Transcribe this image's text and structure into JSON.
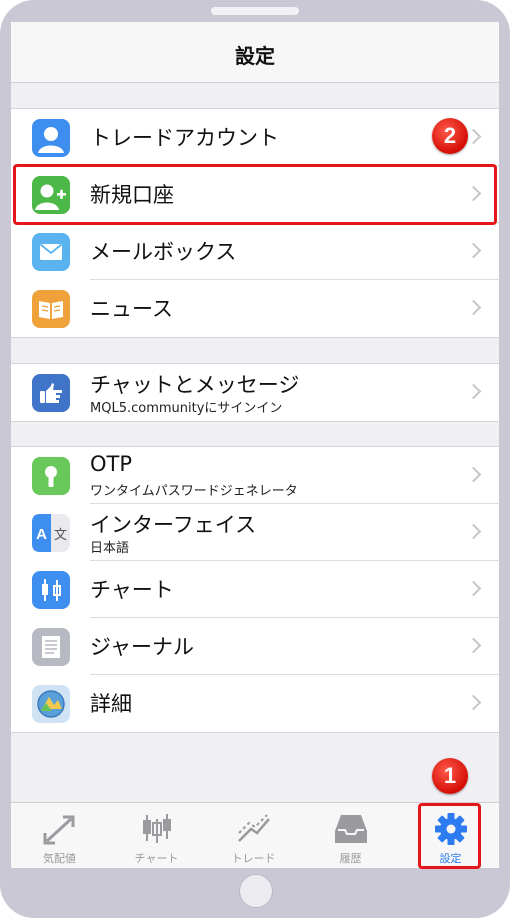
{
  "nav": {
    "title": "設定"
  },
  "groups": [
    {
      "items": [
        {
          "label": "トレードアカウント",
          "icon": "contact-icon",
          "color": "#3e8ef0"
        },
        {
          "label": "新規口座",
          "icon": "add-user-icon",
          "color": "#4cb848"
        },
        {
          "label": "メールボックス",
          "icon": "envelope-icon",
          "color": "#5ab3ef"
        },
        {
          "label": "ニュース",
          "icon": "book-icon",
          "color": "#f0a23a"
        }
      ]
    },
    {
      "items": [
        {
          "label": "チャットとメッセージ",
          "sub": "MQL5.communityにサインイン",
          "icon": "hand-pointer-icon",
          "color": "#3f74c8"
        }
      ]
    },
    {
      "items": [
        {
          "label": "OTP",
          "sub": "ワンタイムパスワードジェネレータ",
          "icon": "keyhole-icon",
          "color": "#68c95a"
        },
        {
          "label": "インターフェイス",
          "sub": "日本語",
          "icon": "translate-icon",
          "color": "#3e8ef0"
        },
        {
          "label": "チャート",
          "icon": "candlestick-icon",
          "color": "#3e8ef0"
        },
        {
          "label": "ジャーナル",
          "icon": "document-lines-icon",
          "color": "#b7b9c2"
        },
        {
          "label": "詳細",
          "icon": "metatrader-logo-icon",
          "color": "#5aa0d8"
        }
      ]
    }
  ],
  "tabs": [
    {
      "label": "気配値",
      "icon": "arrows-diagonal-icon",
      "active": false
    },
    {
      "label": "チャート",
      "icon": "candlestick-icon",
      "active": false
    },
    {
      "label": "トレード",
      "icon": "trend-lines-icon",
      "active": false
    },
    {
      "label": "履歴",
      "icon": "inbox-icon",
      "active": false
    },
    {
      "label": "設定",
      "icon": "gear-icon",
      "active": true
    }
  ],
  "callouts": [
    "1",
    "2"
  ],
  "colors": {
    "accent": "#2d7bf0",
    "highlight": "#e4161a"
  }
}
